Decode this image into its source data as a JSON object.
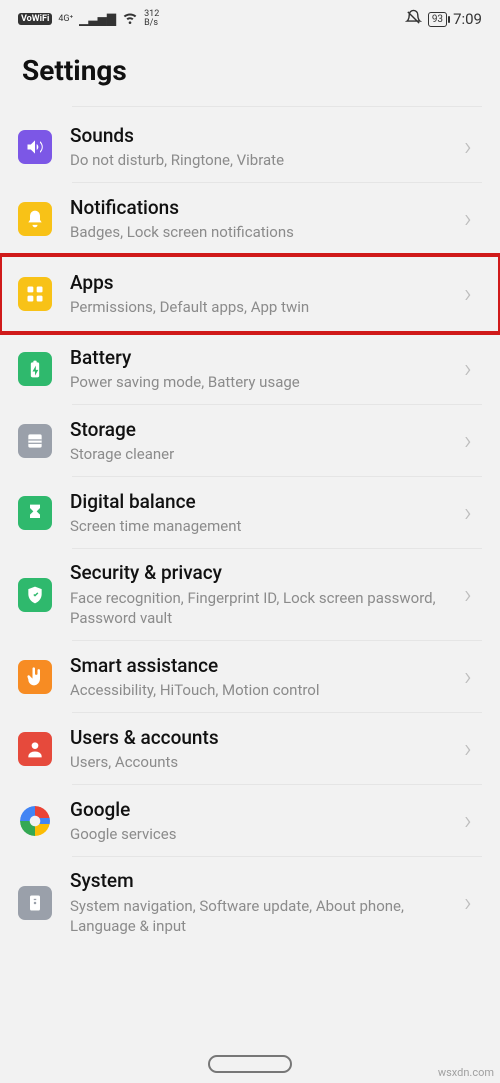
{
  "status": {
    "vowifi": "VoWiFi",
    "net_top": "4G⁺",
    "speed_top": "312",
    "speed_bot": "B/s",
    "battery": "93",
    "clock": "7:09"
  },
  "header": {
    "title": "Settings"
  },
  "rows": [
    {
      "id": "sounds",
      "title": "Sounds",
      "sub": "Do not disturb, Ringtone, Vibrate",
      "bg": "#7c57e6",
      "highlight": false
    },
    {
      "id": "notifications",
      "title": "Notifications",
      "sub": "Badges, Lock screen notifications",
      "bg": "#f8c217",
      "highlight": false
    },
    {
      "id": "apps",
      "title": "Apps",
      "sub": "Permissions, Default apps, App twin",
      "bg": "#f8c217",
      "highlight": true
    },
    {
      "id": "battery",
      "title": "Battery",
      "sub": "Power saving mode, Battery usage",
      "bg": "#2fb96d",
      "highlight": false
    },
    {
      "id": "storage",
      "title": "Storage",
      "sub": "Storage cleaner",
      "bg": "#9aa0aa",
      "highlight": false
    },
    {
      "id": "digital-balance",
      "title": "Digital balance",
      "sub": "Screen time management",
      "bg": "#2fb96d",
      "highlight": false
    },
    {
      "id": "security-privacy",
      "title": "Security & privacy",
      "sub": "Face recognition, Fingerprint ID, Lock screen password, Password vault",
      "bg": "#2fb96d",
      "highlight": false
    },
    {
      "id": "smart-assistance",
      "title": "Smart assistance",
      "sub": "Accessibility, HiTouch, Motion control",
      "bg": "#f78c23",
      "highlight": false
    },
    {
      "id": "users-accounts",
      "title": "Users & accounts",
      "sub": "Users, Accounts",
      "bg": "#e64a3c",
      "highlight": false
    },
    {
      "id": "google",
      "title": "Google",
      "sub": "Google services",
      "bg": "transparent",
      "highlight": false
    },
    {
      "id": "system",
      "title": "System",
      "sub": "System navigation, Software update, About phone, Language & input",
      "bg": "#9aa0aa",
      "highlight": false
    }
  ],
  "watermark": "wsxdn.com"
}
